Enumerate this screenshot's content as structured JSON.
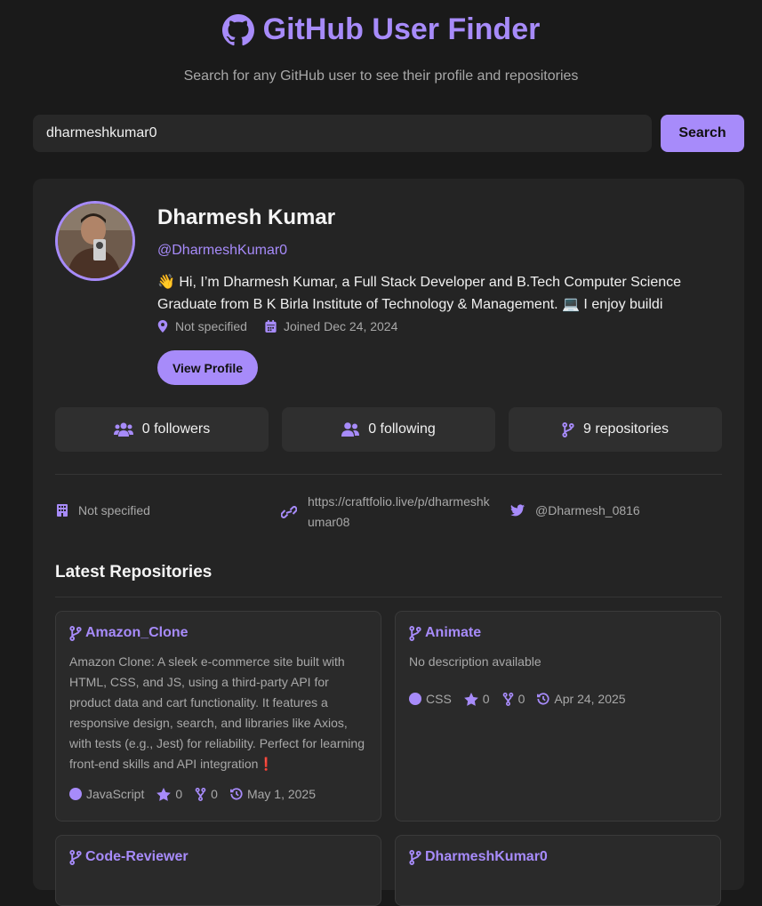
{
  "header": {
    "title": "GitHub User Finder",
    "subtitle": "Search for any GitHub user to see their profile and repositories"
  },
  "search": {
    "value": "dharmeshkumar0",
    "button_label": "Search"
  },
  "profile": {
    "name": "Dharmesh Kumar",
    "login": "@DharmeshKumar0",
    "bio_line1": "👋 Hi, I’m Dharmesh Kumar, a Full Stack Developer and B.Tech Computer Science",
    "bio_line2": "Graduate from B K Birla Institute of Technology & Management. 💻 I enjoy buildi",
    "location": "Not specified",
    "joined": "Joined Dec 24, 2024",
    "view_button": "View Profile"
  },
  "stats": {
    "followers": "0 followers",
    "following": "0 following",
    "repositories": "9 repositories"
  },
  "links": {
    "company": "Not specified",
    "blog_line1": "https://craftfolio.live/p/dharmeshk",
    "blog_line2": "umar08",
    "twitter": "@Dharmesh_0816"
  },
  "repos_section": {
    "title": "Latest Repositories",
    "repos": [
      {
        "name": "Amazon_Clone",
        "description": "Amazon Clone: A sleek e-commerce site built with HTML, CSS, and JS, using a third-party API for product data and cart functionality. It features a responsive design, search, and libraries like Axios, with tests (e.g., Jest) for reliability. Perfect for learning front-end skills and API integration❗",
        "language": "JavaScript",
        "stars": "0",
        "forks": "0",
        "updated": "May 1, 2025"
      },
      {
        "name": "Animate",
        "description": "No description available",
        "language": "CSS",
        "stars": "0",
        "forks": "0",
        "updated": "Apr 24, 2025"
      },
      {
        "name": "Code-Reviewer"
      },
      {
        "name": "DharmeshKumar0"
      }
    ]
  },
  "colors": {
    "accent": "#a78bfa",
    "background": "#1a1a1a",
    "card": "#242424"
  },
  "icons": {
    "title": "github-icon",
    "location": "map-marker-icon",
    "joined": "calendar-icon",
    "followers": "users-icon",
    "following": "user-friends-icon",
    "repositories": "code-branch-icon",
    "company": "building-icon",
    "blog": "link-icon",
    "twitter": "twitter-icon",
    "stars": "star-icon",
    "forks": "fork-icon",
    "updated": "history-icon"
  }
}
